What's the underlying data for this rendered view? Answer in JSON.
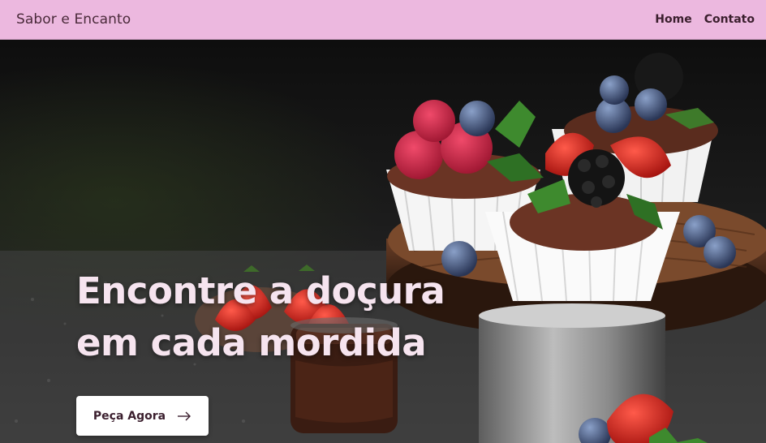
{
  "navbar": {
    "brand": "Sabor e Encanto",
    "links": [
      {
        "label": "Home"
      },
      {
        "label": "Contato"
      }
    ]
  },
  "hero": {
    "title_line1": "Encontre a doçura",
    "title_line2": "em cada mordida",
    "cta_label": "Peça Agora",
    "cta_icon": "arrow-right-icon",
    "background_image": "cupcakes-with-berries-on-wooden-stand"
  },
  "colors": {
    "navbar_bg": "#ecb8df",
    "nav_text": "#3b1f2e",
    "hero_title": "#f6e4ef",
    "button_bg": "#ffffff"
  }
}
